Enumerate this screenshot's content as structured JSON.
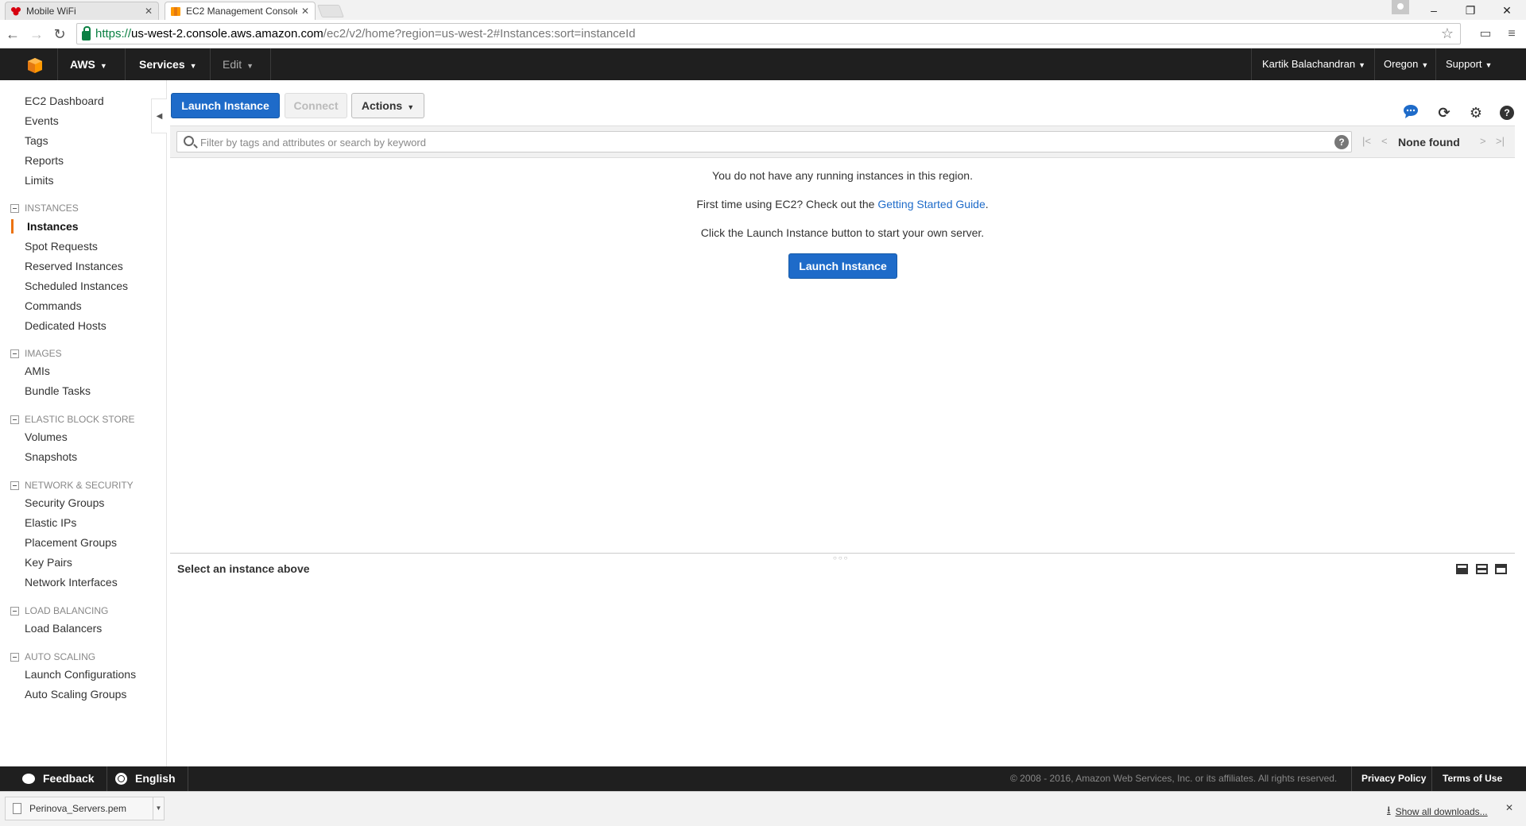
{
  "browser": {
    "tabs": [
      {
        "title": "Mobile WiFi",
        "active": false
      },
      {
        "title": "EC2 Management Console",
        "active": true
      }
    ],
    "window_controls": {
      "minimize": "–",
      "restore": "❐",
      "close": "✕"
    },
    "url": {
      "scheme": "https://",
      "host": "us-west-2.console.aws.amazon.com",
      "path": "/ec2/v2/home?region=us-west-2#Instances:sort=instanceId"
    }
  },
  "awsnav": {
    "brand": "AWS",
    "services": "Services",
    "edit": "Edit",
    "user": "Kartik Balachandran",
    "region": "Oregon",
    "support": "Support",
    "accent": "#f90"
  },
  "sidebar": {
    "top_items": [
      "EC2 Dashboard",
      "Events",
      "Tags",
      "Reports",
      "Limits"
    ],
    "sections": [
      {
        "title": "INSTANCES",
        "items": [
          "Instances",
          "Spot Requests",
          "Reserved Instances",
          "Scheduled Instances",
          "Commands",
          "Dedicated Hosts"
        ]
      },
      {
        "title": "IMAGES",
        "items": [
          "AMIs",
          "Bundle Tasks"
        ]
      },
      {
        "title": "ELASTIC BLOCK STORE",
        "items": [
          "Volumes",
          "Snapshots"
        ]
      },
      {
        "title": "NETWORK & SECURITY",
        "items": [
          "Security Groups",
          "Elastic IPs",
          "Placement Groups",
          "Key Pairs",
          "Network Interfaces"
        ]
      },
      {
        "title": "LOAD BALANCING",
        "items": [
          "Load Balancers"
        ]
      },
      {
        "title": "AUTO SCALING",
        "items": [
          "Launch Configurations",
          "Auto Scaling Groups"
        ]
      }
    ],
    "active_item": "Instances"
  },
  "toolbar": {
    "launch": "Launch Instance",
    "connect": "Connect",
    "actions": "Actions"
  },
  "search": {
    "placeholder": "Filter by tags and attributes or search by keyword",
    "help": "?",
    "pager_status": "None found"
  },
  "main": {
    "no_instances": "You do not have any running instances in this region.",
    "first_time_prefix": "First time using EC2? Check out the",
    "guide_link": "Getting Started Guide",
    "first_time_suffix": ".",
    "click_launch": "Click the Launch Instance button to start your own server.",
    "launch_button": "Launch Instance"
  },
  "detail": {
    "title": "Select an instance above"
  },
  "footer": {
    "feedback": "Feedback",
    "language": "English",
    "copyright": "© 2008 - 2016, Amazon Web Services, Inc. or its affiliates. All rights reserved.",
    "privacy": "Privacy Policy",
    "terms": "Terms of Use"
  },
  "downloads": {
    "file": "Perinova_Servers.pem",
    "show_all": "Show all downloads..."
  }
}
